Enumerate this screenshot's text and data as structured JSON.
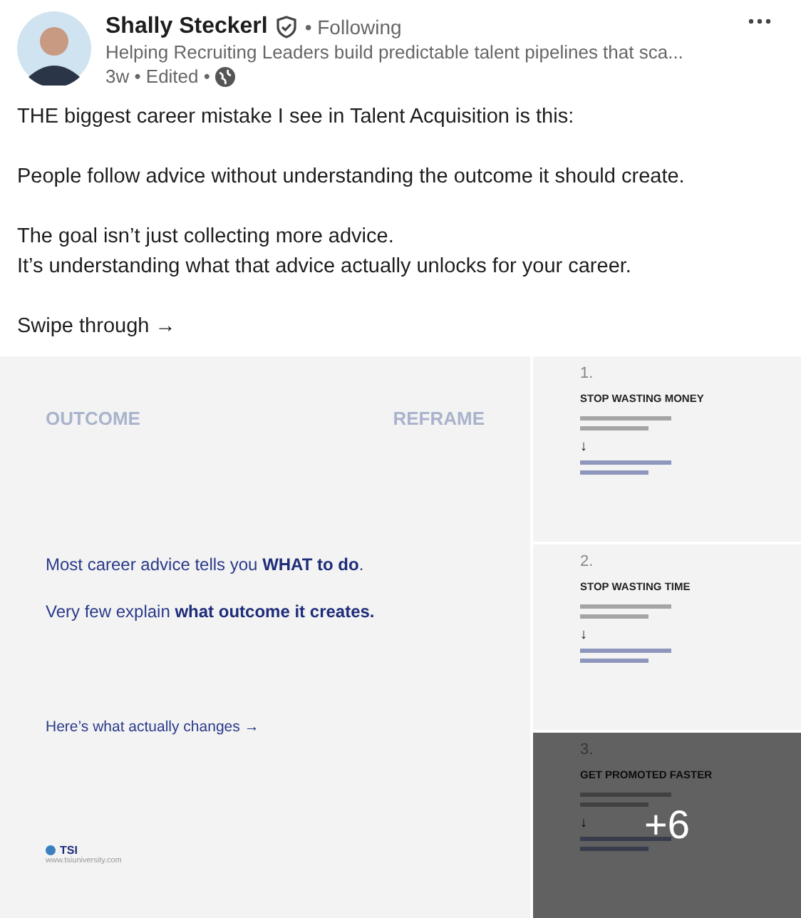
{
  "author": {
    "name": "Shally Steckerl",
    "status": "• Following",
    "headline": "Helping Recruiting Leaders build predictable talent pipelines that sca...",
    "time": "3w • Edited •"
  },
  "post": {
    "paragraphs": [
      "THE biggest career mistake I see in Talent Acquisition is this:",
      "People follow advice without understanding the outcome it should create.",
      "The goal isn’t just collecting more advice.\nIt’s understanding what that advice actually unlocks for your career.",
      "Swipe through →"
    ]
  },
  "slide": {
    "left_label": "OUTCOME",
    "right_label": "REFRAME",
    "lines": [
      "Most career advice tells you **WHAT to do**.",
      "Very few explain **what outcome it creates.**"
    ],
    "cta": "Here’s what actually changes →",
    "logo": "TSI",
    "url": "www.tsiuniversity.com"
  },
  "tiles": [
    {
      "number": "1.",
      "title": "STOP WASTING MONEY",
      "arrow": "↓",
      "overlay": false
    },
    {
      "number": "2.",
      "title": "STOP WASTING TIME",
      "arrow": "↓",
      "overlay": false
    },
    {
      "number": "3.",
      "title": "GET PROMOTED FASTER",
      "arrow": "↓",
      "overlay": true
    }
  ],
  "more_count": "+6"
}
